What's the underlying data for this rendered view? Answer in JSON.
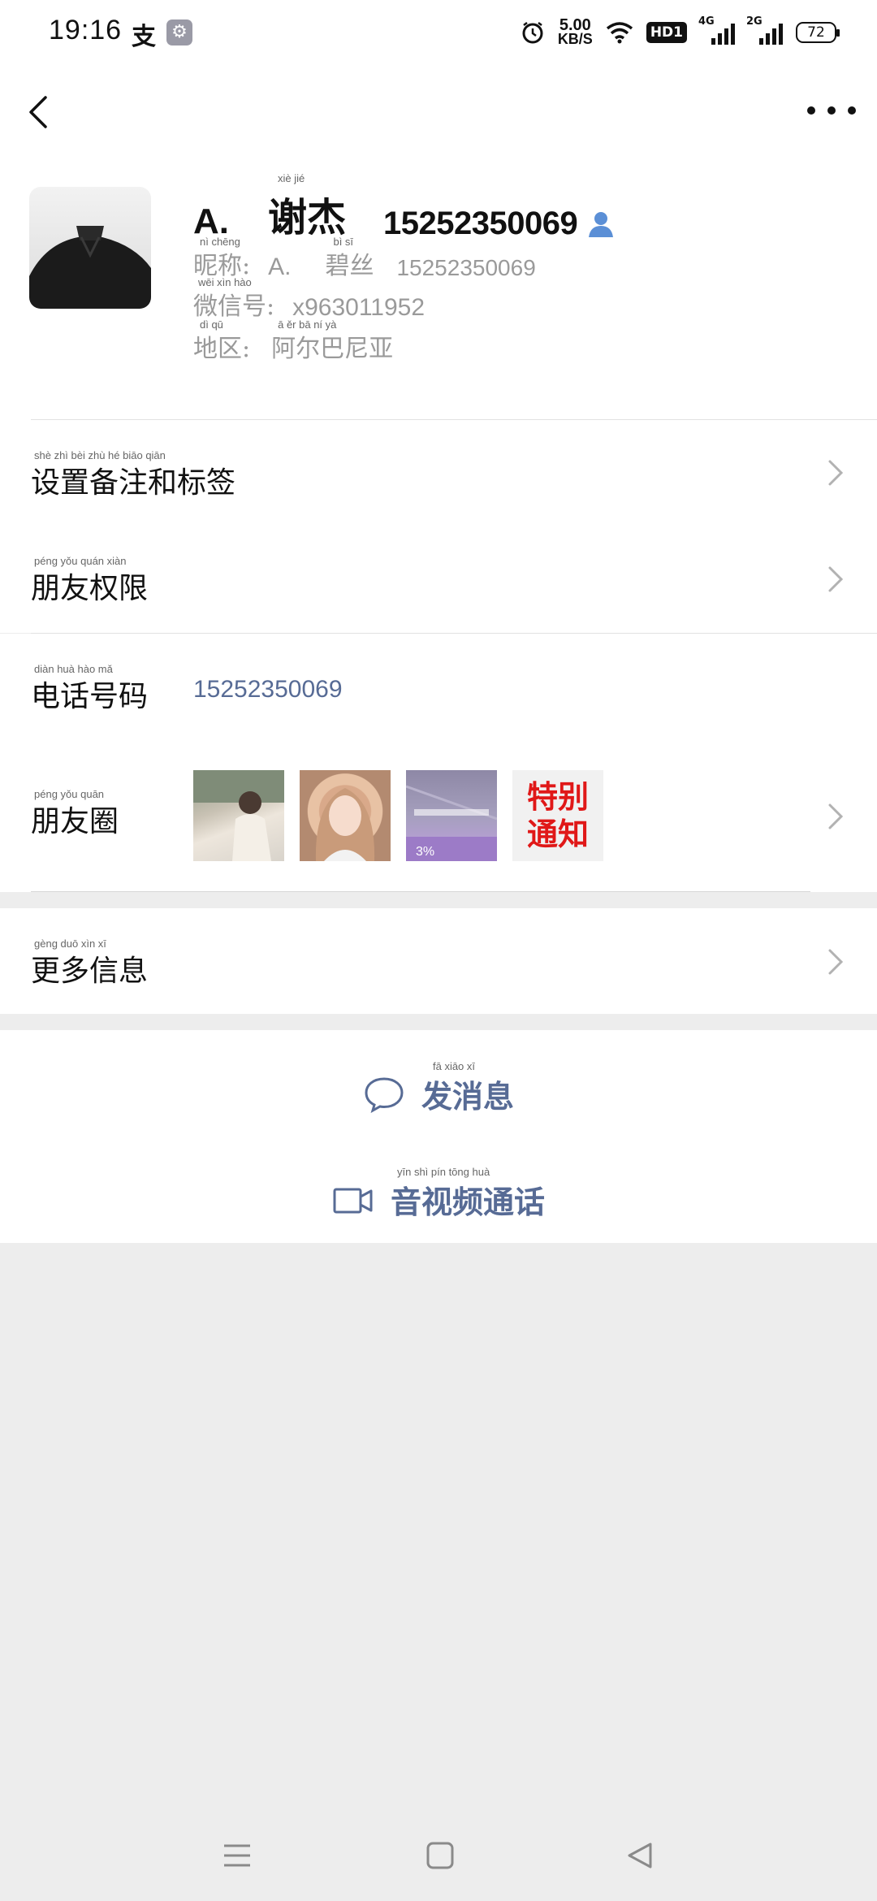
{
  "status_bar": {
    "time": "19:16",
    "alipay_glyph": "支",
    "speed_value": "5.00",
    "speed_unit": "KB/S",
    "hd_badge": "HD1",
    "signal1_label": "4G",
    "signal2_label": "2G",
    "battery": "72"
  },
  "profile": {
    "remark_name_latin": "A.",
    "remark_name_cn": "谢杰",
    "remark_name_cn_pinyin": "xiè jié",
    "remark_phone": "15252350069",
    "nickname_label": "昵称:",
    "nickname_label_pinyin": "nì chēng",
    "nickname_latin": "A.",
    "nickname_cn": "碧丝",
    "nickname_cn_pinyin": "bì sī",
    "nickname_phone": "15252350069",
    "wechat_id_label": "微信号:",
    "wechat_id_label_pinyin": "wēi xìn hào",
    "wechat_id": "x963011952",
    "region_label": "地区:",
    "region_label_pinyin": "dì qū",
    "region": "阿尔巴尼亚",
    "region_pinyin": "ā ěr bā ní yà"
  },
  "rows": {
    "remarks_tags": {
      "label": "设置备注和标签",
      "pinyin": "shè zhì bèi zhù hé biāo qiān"
    },
    "friend_permissions": {
      "label": "朋友权限",
      "pinyin": "péng yǒu quán xiàn"
    },
    "phone": {
      "label": "电话号码",
      "pinyin": "diàn huà hào mǎ",
      "value": "15252350069"
    },
    "moments": {
      "label": "朋友圈",
      "pinyin": "péng yǒu quān",
      "notice_line1": "特别",
      "notice_line2": "通知"
    },
    "more_info": {
      "label": "更多信息",
      "pinyin": "gèng duō xìn xī"
    }
  },
  "actions": {
    "send_message": {
      "label": "发消息",
      "pinyin": "fā xiāo xī",
      "icon": "chat-bubble-icon"
    },
    "video_call": {
      "label": "音视频通话",
      "pinyin": "yīn shì pín tōng huà",
      "icon": "video-camera-icon"
    }
  },
  "colors": {
    "link_blue": "#576b95",
    "notice_red": "#e01818",
    "background": "#ededed"
  }
}
